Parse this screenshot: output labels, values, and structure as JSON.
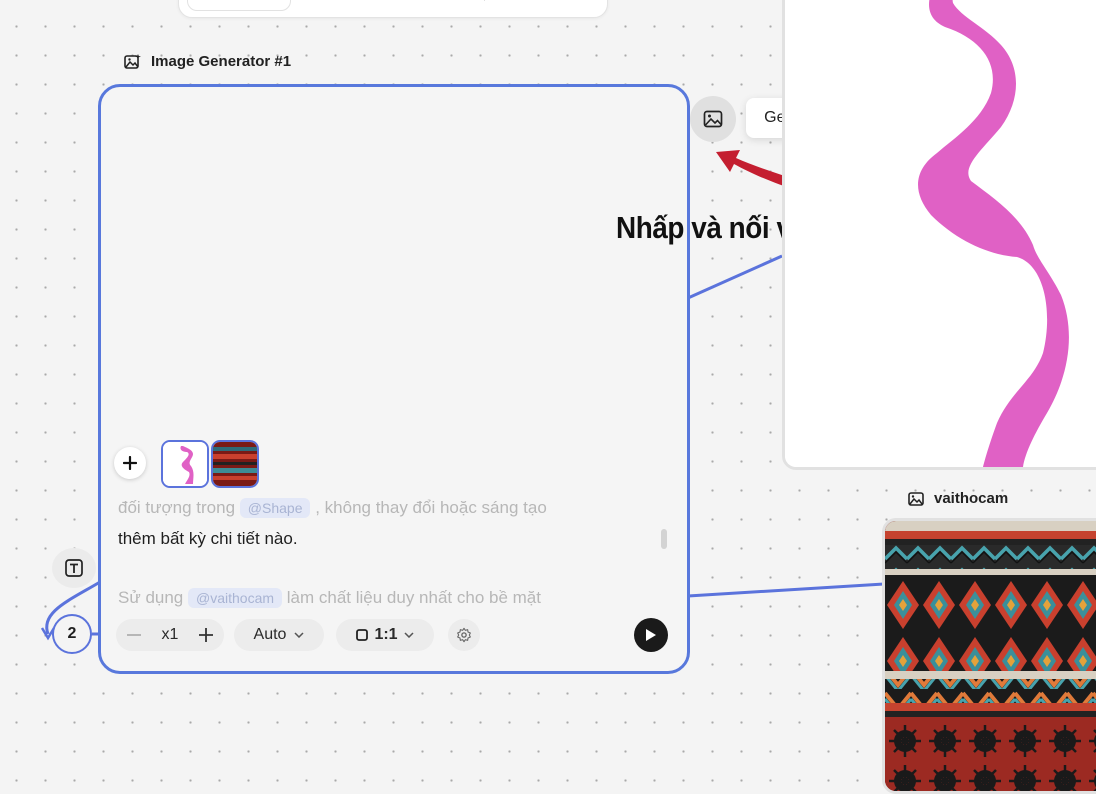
{
  "generator_node": {
    "title": "Image Generator #1",
    "prompt": {
      "line1_part1": "đối tượng trong",
      "line1_mention": "@Shape",
      "line1_part2": ", không thay đổi hoặc sáng tạo",
      "line2": "thêm bất kỳ chi tiết nào.",
      "line3_part1": "Sử dụng",
      "line3_mention": "@vaithocam",
      "line3_part2": "làm chất liệu duy nhất cho bề mặt"
    },
    "toolbar": {
      "quantity": "x1",
      "mode": "Auto",
      "ratio": "1:1"
    },
    "input_count": "2"
  },
  "output_tooltip": "Generated image",
  "annotation": "Nhấp và nối vào ảnh",
  "texture_node": {
    "title": "vaithocam"
  },
  "colors": {
    "accent": "#5878dc",
    "arrow": "#c41e30",
    "shape": "#e061c5",
    "fabric_red": "#8e1f1a"
  }
}
